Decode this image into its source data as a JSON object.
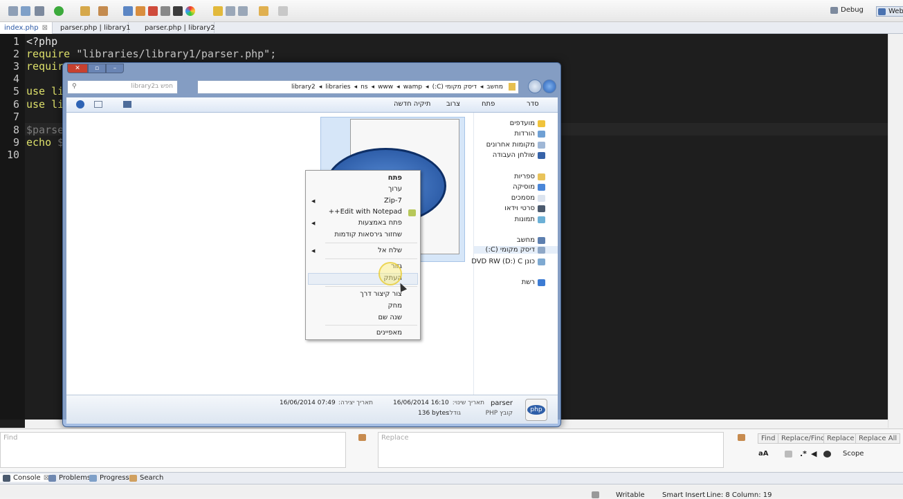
{
  "toolbar": {
    "debug_label": "Debug",
    "web_label": "Web"
  },
  "editor_tabs": [
    {
      "label": "index.php"
    },
    {
      "label": "parser.php | library1"
    },
    {
      "label": "parser.php | library2"
    }
  ],
  "code": {
    "line_numbers": [
      "1",
      "2",
      "3",
      "4",
      "5",
      "6",
      "7",
      "8",
      "9",
      "10"
    ],
    "line1": "<?php",
    "line2_kw": "require",
    "line2_str": "\"libraries/library1/parser.php\";",
    "line3": "requir",
    "line5": "use li",
    "line6": "use li",
    "line8": "$parse",
    "line9_kw": "echo",
    "line9_var": "$"
  },
  "explorer": {
    "search_placeholder": "חפש בlibrary2",
    "address_parts": [
      "מחשב",
      "דיסק מקומי (C:)",
      "wamp",
      "www",
      "ns",
      "libraries",
      "library2"
    ],
    "commands": {
      "organize": "סדר",
      "open": "פתח",
      "burn": "צרוב",
      "new_folder": "תיקיה חדשה"
    },
    "nav": {
      "favorites": "מועדפים",
      "downloads": "הורדות",
      "recent": "מקומות אחרונים",
      "desktop": "שולחן העבודה",
      "libraries": "ספריות",
      "music": "מוסיקה",
      "documents": "מסמכים",
      "videos": "סרטי וידאו",
      "pictures": "תמונות",
      "computer": "מחשב",
      "local_disk": "דיסק מקומי (C:)",
      "dvd": "כונן DVD RW (D:) C",
      "network": "רשת"
    },
    "details": {
      "file_name": "parser",
      "file_type": "קובץ PHP",
      "modified_label": "תאריך שינוי:",
      "modified_value": "16/06/2014 16:10",
      "size_label": "גודל:",
      "size_value": "136 bytes",
      "created_label": "תאריך יצירה:",
      "created_value": "16/06/2014 07:49"
    },
    "php_badge": "php"
  },
  "context_menu": {
    "open": "פתח",
    "edit": "ערוך",
    "zip": "7-Zip",
    "notepad": "Edit with Notepad++",
    "open_with": "פתח באמצעות",
    "restore": "שחזור גירסאות קודמות",
    "send_to": "שלח אל",
    "cut": "גזור",
    "copy": "העתק",
    "shortcut": "צור קיצור דרך",
    "delete": "מחק",
    "rename": "שנה שם",
    "properties": "מאפיינים"
  },
  "findbar": {
    "find_placeholder": "Find",
    "replace_placeholder": "Replace",
    "find_btn": "Find",
    "replace_find_btn": "Replace/Find",
    "replace_btn": "Replace",
    "replace_all_btn": "Replace All",
    "scope_label": "Scope"
  },
  "bottom_tabs": [
    "Console",
    "Problems",
    "Progress",
    "Search"
  ],
  "status": {
    "writable": "Writable",
    "insert_mode": "Smart Insert",
    "position": "Line: 8 Column: 19"
  },
  "colors": {
    "editor_bg": "#1e1e1e",
    "keyword": "#dde06a",
    "selection_blue": "#3a75c4"
  }
}
